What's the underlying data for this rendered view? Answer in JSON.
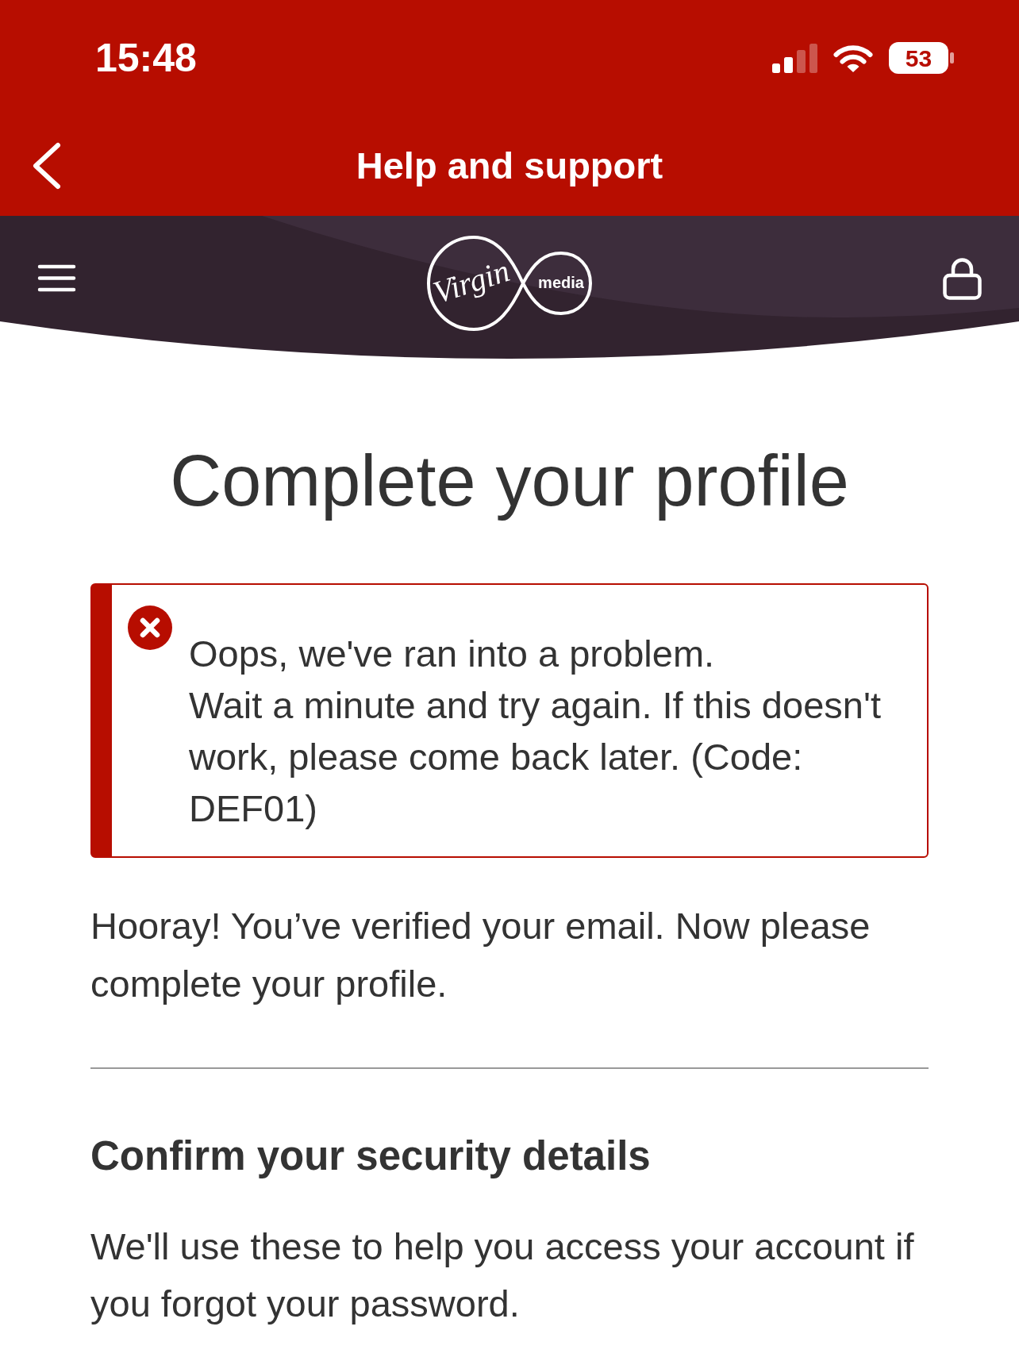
{
  "status_bar": {
    "time": "15:48",
    "battery": "53"
  },
  "nav_bar": {
    "title": "Help and support"
  },
  "brand_bar": {
    "logo": {
      "script": "Virgin",
      "wordmark": "media"
    }
  },
  "page": {
    "title": "Complete your profile",
    "alert": {
      "kind": "error",
      "heading": "Oops, we've ran into a problem.",
      "message": "Wait a minute and try again. If this doesn't work, please come back later. (Code: DEF01)"
    },
    "intro": "Hooray! You’ve verified your email. Now please complete your profile.",
    "section": {
      "title": "Confirm your security details",
      "text": "We'll use these to help you access your account if you forgot your password."
    }
  }
}
